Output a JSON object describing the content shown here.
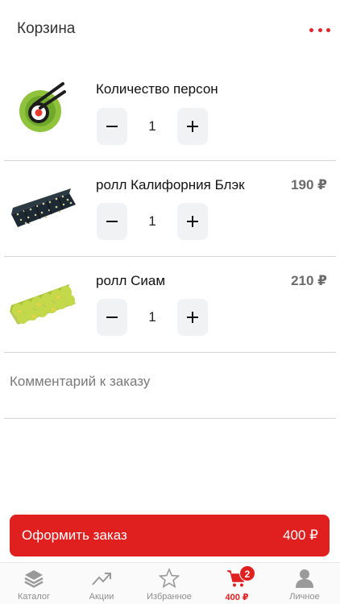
{
  "header": {
    "title": "Корзина"
  },
  "persons": {
    "label": "Количество персон",
    "quantity": "1"
  },
  "items": [
    {
      "name": "ролл Калифорния Блэк",
      "price": "190 ₽",
      "quantity": "1"
    },
    {
      "name": "ролл Сиам",
      "price": "210 ₽",
      "quantity": "1"
    }
  ],
  "comment": {
    "placeholder": "Комментарий к заказу"
  },
  "checkout": {
    "label": "Оформить заказ",
    "total": "400 ₽"
  },
  "tabbar": {
    "tabs": [
      {
        "label": "Каталог",
        "icon": "layers-icon"
      },
      {
        "label": "Акции",
        "icon": "trending-up-icon"
      },
      {
        "label": "Избранное",
        "icon": "star-icon"
      },
      {
        "label": "400 ₽",
        "icon": "cart-icon",
        "badge": "2",
        "active": true
      },
      {
        "label": "Личное",
        "icon": "user-icon"
      }
    ]
  },
  "colors": {
    "accent": "#e0201f",
    "stepper_bg": "#f1f2f4",
    "divider": "#d4d4d4"
  }
}
